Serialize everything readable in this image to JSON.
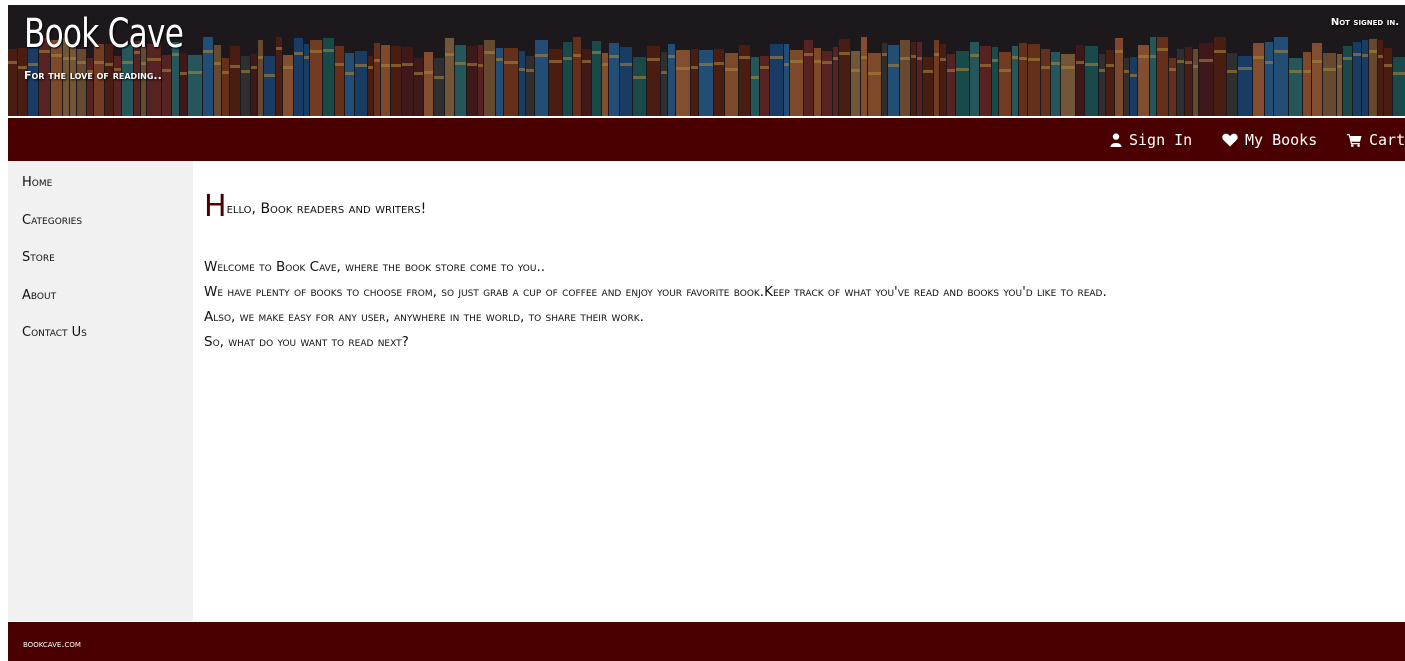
{
  "header": {
    "title": "Book Cave",
    "tagline": "For the love of reading..",
    "status": "Not signed in."
  },
  "nav": {
    "items": [
      {
        "label": "Sign In",
        "icon": "user-icon"
      },
      {
        "label": "My Books",
        "icon": "heart-icon"
      },
      {
        "label": "Cart",
        "icon": "cart-icon"
      }
    ]
  },
  "sidebar": {
    "items": [
      {
        "label": "Home"
      },
      {
        "label": "Categories"
      },
      {
        "label": "Store"
      },
      {
        "label": "About"
      },
      {
        "label": "Contact Us"
      }
    ]
  },
  "main": {
    "greeting_first": "H",
    "greeting_rest": "ello, Book readers and writers!",
    "paragraphs": [
      "Welcome to Book Cave, where the book store come to you..",
      "We have plenty of books to choose from, so just grab a cup of coffee and enjoy your favorite book.Keep track of what you've read and books you'd like to read.",
      "Also, we make easy for any user, anywhere in the world, to share their work.",
      "So, what do you want to read next?"
    ]
  },
  "footer": {
    "text": "bookcave.com"
  },
  "colors": {
    "brand": "#4a0000",
    "sidebar_bg": "#f1f1f1",
    "header_bg": "#1f1b1d"
  }
}
